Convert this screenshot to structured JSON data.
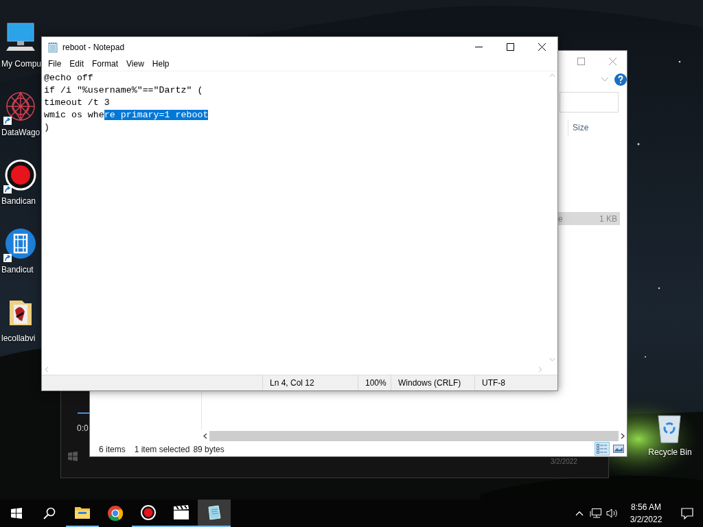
{
  "desktop_icons": [
    {
      "label": "My Compu",
      "kind": "computer",
      "shortcut": false
    },
    {
      "label": "DataWago",
      "kind": "mandala",
      "shortcut": true
    },
    {
      "label": "Bandican",
      "kind": "record",
      "shortcut": true
    },
    {
      "label": "Bandicut",
      "kind": "film",
      "shortcut": true
    },
    {
      "label": "lecollabvi",
      "kind": "folder",
      "shortcut": false
    }
  ],
  "recycle_bin": {
    "label": "Recycle Bin"
  },
  "media_window": {
    "time": "0:0",
    "date": "3/2/2022"
  },
  "explorer": {
    "column_header": "Size",
    "row": {
      "column_3": "e",
      "size": "1 KB",
      "selected": true
    },
    "status": {
      "items": "6 items",
      "selection": "1 item selected",
      "size": "89 bytes"
    },
    "views": [
      {
        "kind": "details",
        "selected": true
      },
      {
        "kind": "preview",
        "selected": false
      }
    ]
  },
  "notepad": {
    "title": "reboot - Notepad",
    "menu": [
      "File",
      "Edit",
      "Format",
      "View",
      "Help"
    ],
    "lines": [
      {
        "segments": [
          {
            "text": "@echo off",
            "selected": false
          }
        ]
      },
      {
        "segments": [
          {
            "text": "if /i \"%username%\"==\"Dartz\" (",
            "selected": false
          }
        ]
      },
      {
        "segments": [
          {
            "text": "timeout /t 3",
            "selected": false
          }
        ]
      },
      {
        "segments": [
          {
            "text": "wmic os whe",
            "selected": false
          },
          {
            "text": "re primary=1 reboot",
            "selected": true
          }
        ]
      },
      {
        "segments": [
          {
            "text": ")",
            "selected": false
          }
        ]
      }
    ],
    "status": [
      "Ln 4, Col 12",
      "100%",
      "Windows (CRLF)",
      "UTF-8"
    ]
  },
  "taskbar": {
    "apps": [
      {
        "kind": "explorer",
        "running": true,
        "active": false
      },
      {
        "kind": "chrome",
        "running": false,
        "active": false
      },
      {
        "kind": "record",
        "running": true,
        "active": false
      },
      {
        "kind": "clapper",
        "running": true,
        "active": false
      },
      {
        "kind": "notepad",
        "running": true,
        "active": true
      }
    ],
    "time": "8:56 AM",
    "date": "3/2/2022"
  }
}
